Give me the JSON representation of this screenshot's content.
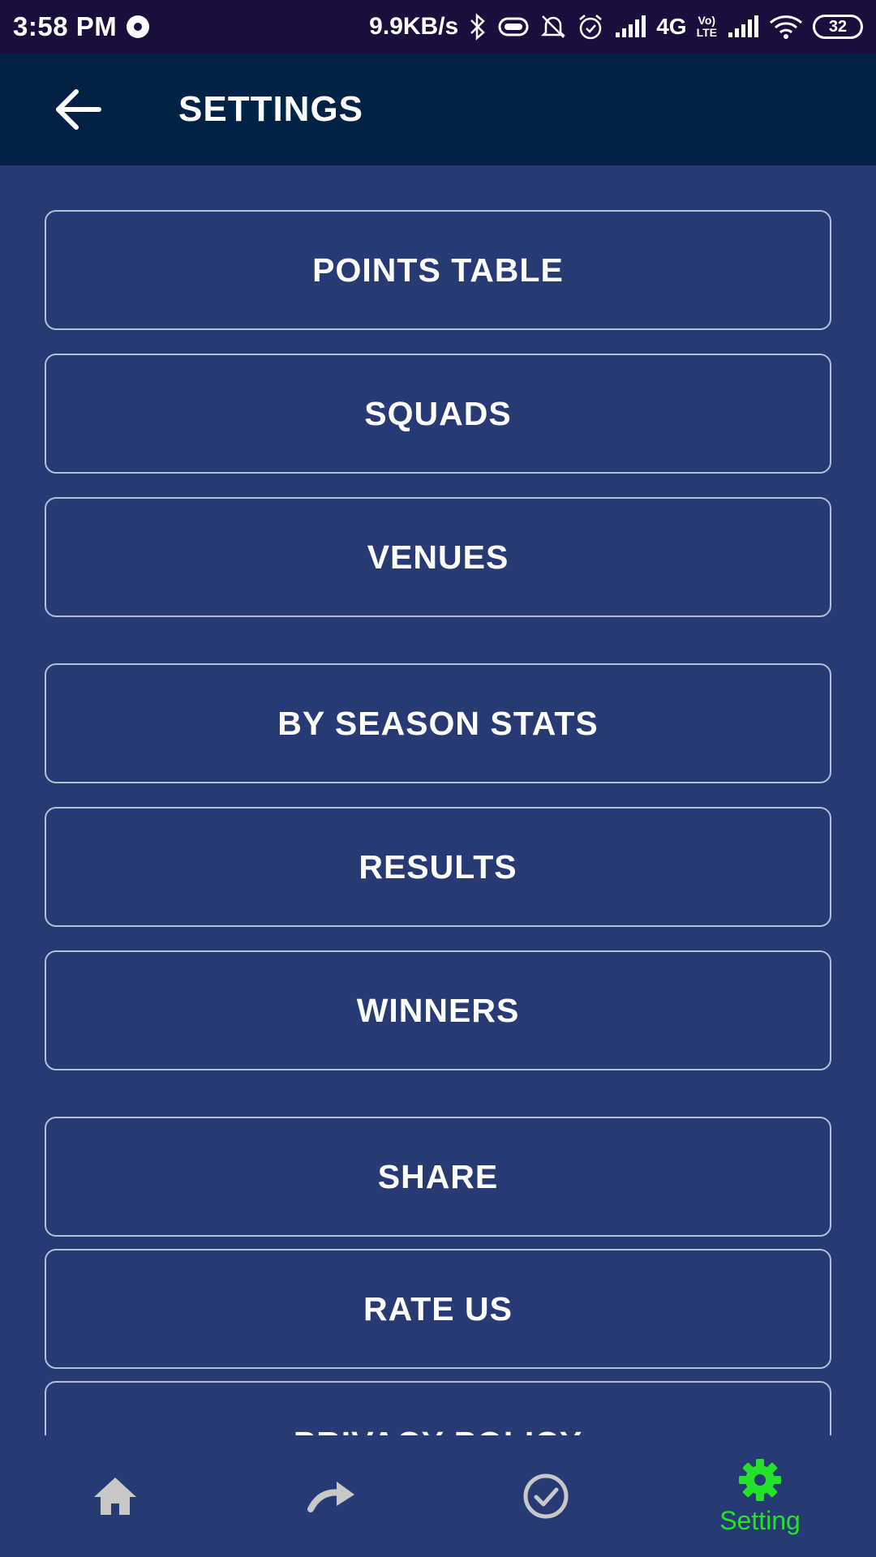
{
  "status_bar": {
    "time": "3:58 PM",
    "speed": "9.9KB/s",
    "network": "4G",
    "volte_top": "Vo)",
    "volte_bottom": "LTE",
    "battery": "32"
  },
  "app_bar": {
    "title": "SETTINGS",
    "back_icon": "arrow-left-icon"
  },
  "menu": {
    "items": [
      {
        "label": "POINTS TABLE"
      },
      {
        "label": "SQUADS"
      },
      {
        "label": "VENUES"
      },
      {
        "label": "BY SEASON STATS"
      },
      {
        "label": "RESULTS"
      },
      {
        "label": "WINNERS"
      },
      {
        "label": "SHARE"
      },
      {
        "label": "RATE US"
      },
      {
        "label": "PRIVACY POLICY"
      }
    ]
  },
  "bottom_nav": {
    "items": [
      {
        "icon": "home-icon",
        "label": ""
      },
      {
        "icon": "redo-arrow-icon",
        "label": ""
      },
      {
        "icon": "check-circle-icon",
        "label": ""
      },
      {
        "icon": "gear-icon",
        "label": "Setting"
      }
    ],
    "active_color": "#24e12a",
    "inactive_color": "#c8c8c8"
  },
  "colors": {
    "status_bar": "#1a0f3c",
    "app_bar": "#022245",
    "background": "#283a73",
    "button_border": "#b5bfd6"
  }
}
